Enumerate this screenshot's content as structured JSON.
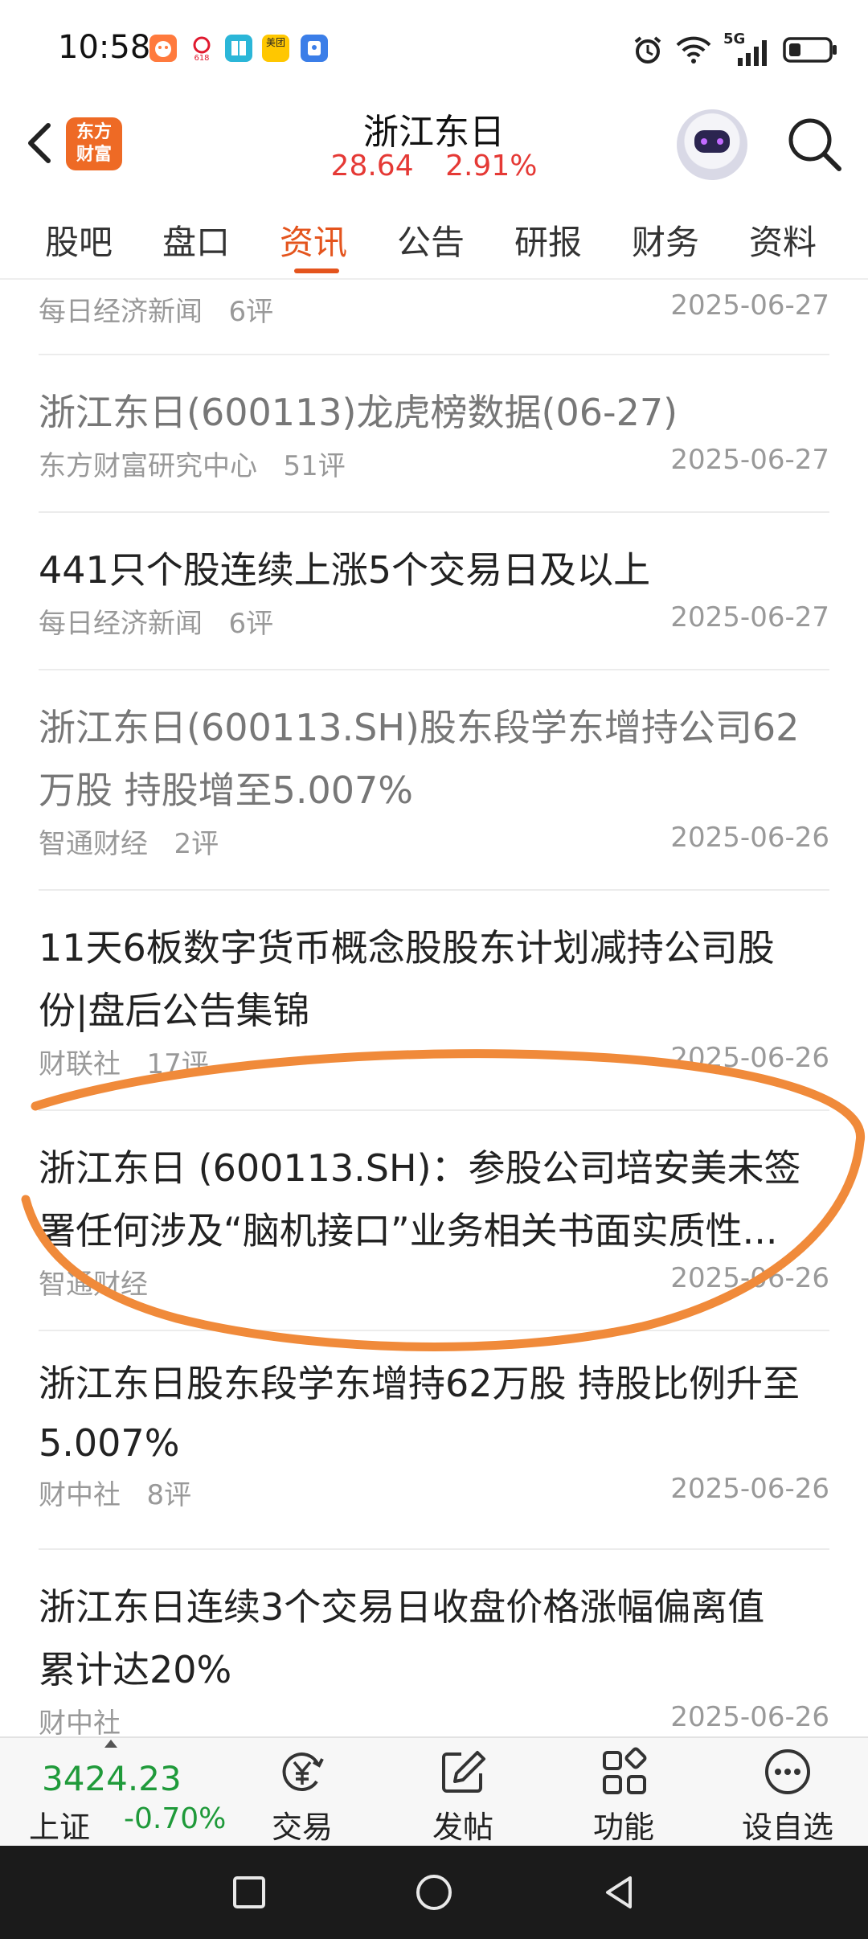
{
  "status_bar": {
    "time": "10:58",
    "network": "5G",
    "app_icons": [
      {
        "name": "taobao-icon",
        "color": "#ff6d3a",
        "text": "淘"
      },
      {
        "name": "jd-618-icon",
        "color": "#e0192e",
        "text": "618"
      },
      {
        "name": "reader-icon",
        "color": "#2bb6d8",
        "text": ""
      },
      {
        "name": "meituan-icon",
        "color": "#ffc700",
        "text": "美团"
      },
      {
        "name": "app-icon",
        "color": "#3b7ee8",
        "text": ""
      }
    ]
  },
  "header": {
    "logo_line1": "东方",
    "logo_line2": "财富",
    "stock_name": "浙江东日",
    "price": "28.64",
    "change_pct": "2.91%"
  },
  "tabs": [
    {
      "label": "股吧",
      "active": false
    },
    {
      "label": "盘口",
      "active": false
    },
    {
      "label": "资讯",
      "active": true
    },
    {
      "label": "公告",
      "active": false
    },
    {
      "label": "研报",
      "active": false
    },
    {
      "label": "财务",
      "active": false
    },
    {
      "label": "资料",
      "active": false
    }
  ],
  "news": [
    {
      "title": "",
      "source": "每日经济新闻",
      "comments": "6评",
      "date": "2025-06-27",
      "read": false
    },
    {
      "title": "浙江东日(600113)龙虎榜数据(06-27)",
      "source": "东方财富研究中心",
      "comments": "51评",
      "date": "2025-06-27",
      "read": true
    },
    {
      "title": "441只个股连续上涨5个交易日及以上",
      "source": "每日经济新闻",
      "comments": "6评",
      "date": "2025-06-27",
      "read": false
    },
    {
      "title_line1": "浙江东日(600113.SH)股东段学东增持公司62",
      "title_line2": "万股 持股增至5.007%",
      "source": "智通财经",
      "comments": "2评",
      "date": "2025-06-26",
      "read": true
    },
    {
      "title_line1": "11天6板数字货币概念股股东计划减持公司股",
      "title_line2": "份|盘后公告集锦",
      "source": "财联社",
      "comments": "17评",
      "date": "2025-06-26",
      "read": false
    },
    {
      "title_line1": "浙江东日 (600113.SH)：参股公司培安美未签",
      "title_line2": "署任何涉及“脑机接口”业务相关书面实质性...",
      "source": "智通财经",
      "comments": "",
      "date": "2025-06-26",
      "read": false
    },
    {
      "title_line1": "浙江东日股东段学东增持62万股 持股比例升至",
      "title_line2": "5.007%",
      "source": "财中社",
      "comments": "8评",
      "date": "2025-06-26",
      "read": false
    },
    {
      "title_line1": "浙江东日连续3个交易日收盘价格涨幅偏离值",
      "title_line2": "累计达20%",
      "source": "财中社",
      "comments": "",
      "date": "2025-06-26",
      "read": false
    }
  ],
  "bottom_nav": {
    "index_value": "3424.23",
    "index_name": "上证",
    "index_change": "-0.70%",
    "buttons": [
      {
        "label": "交易",
        "icon": "trade-yen-icon"
      },
      {
        "label": "发帖",
        "icon": "post-edit-icon"
      },
      {
        "label": "功能",
        "icon": "grid-functions-icon"
      },
      {
        "label": "设自选",
        "icon": "more-dots-icon"
      }
    ]
  },
  "colors": {
    "accent": "#e4541d",
    "up_red": "#e53935",
    "down_green": "#1f9a3a",
    "annotation_orange": "#f08a3a"
  }
}
